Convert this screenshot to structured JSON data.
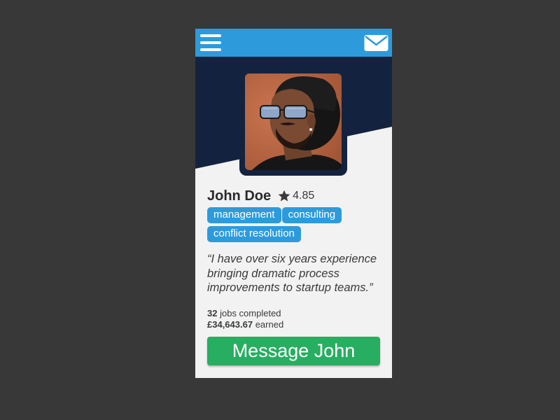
{
  "colors": {
    "background": "#393838",
    "topbar": "#2d9bdb",
    "hero": "#13233f",
    "card": "#f2f2f2",
    "tag": "#2d9bdb",
    "button": "#27ae60"
  },
  "topbar": {
    "menu_icon": "hamburger-menu",
    "mail_icon": "envelope"
  },
  "profile": {
    "name": "John Doe",
    "rating_icon": "star",
    "rating": "4.85",
    "photo_icon": "profile-photo"
  },
  "tags": [
    "management",
    "consulting",
    "conflict resolution"
  ],
  "quote": "“I have over six years experience bringing dramatic process improvements to startup teams.”",
  "stats": {
    "jobs_value": "32",
    "jobs_label": "jobs completed",
    "earned_value": "£34,643.67",
    "earned_label": "earned"
  },
  "cta": {
    "label": "Message John"
  }
}
